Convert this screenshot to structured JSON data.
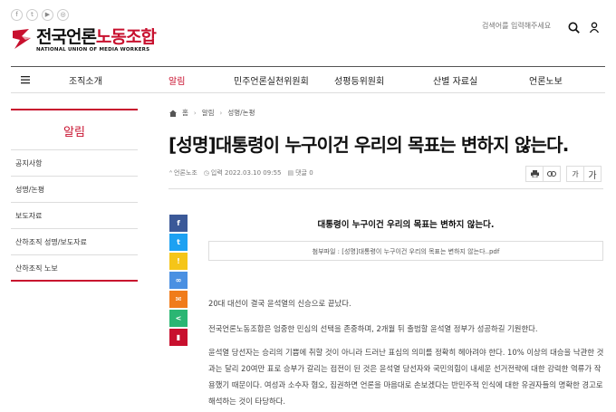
{
  "social": [
    "f",
    "t",
    "▶",
    "◎"
  ],
  "logo": {
    "ko_prefix": "전국언론",
    "ko_suffix": "노동조합",
    "en": "NATIONAL UNION OF MEDIA WORKERS"
  },
  "search": {
    "placeholder": "검색어를 입력해주세요"
  },
  "nav": {
    "items": [
      "조직소개",
      "알림",
      "민주언론실천위원회",
      "성평등위원회",
      "산별 자료실",
      "언론노보"
    ],
    "active": "알림"
  },
  "sidebar": {
    "title": "알림",
    "items": [
      "공지사항",
      "성명/논평",
      "보도자료",
      "산하조직 성명/보도자료",
      "산하조직 노보"
    ]
  },
  "breadcrumb": {
    "home": "홈",
    "level1": "알림",
    "level2": "성명/논평"
  },
  "article": {
    "title": "[성명]대통령이 누구이건 우리의 목표는 변하지 않는다.",
    "author": "언론노조",
    "date": "입력 2022.03.10 09:55",
    "comments": "댓글 0",
    "font_small": "가",
    "font_large": "가",
    "subhead": "대통령이 누구이건 우리의 목표는 변하지 않는다.",
    "attachment": "첨부파일 : [성명]대통령이 누구이건 우리의 목표는 변하지 않는다..pdf",
    "paragraphs": [
      "20대 대선이 결국 윤석열의 신승으로 끝났다.",
      "전국언론노동조합은 엄중한 민심의 선택을 존중하며, 2개월 뒤 출범할 윤석열 정부가 성공하길 기원한다.",
      "윤석열 당선자는 승리의 기쁨에 취할 것이 아니라 드러난 표심의 의미를 정확히 헤아려야 한다. 10% 이상의 대승을 낙관한 것과는 달리 20여만 표로 승부가 갈리는 접전이 된 것은 윤석열 당선자와 국민의힘이 내세운 선거전략에 대한 강력한 역류가 작용했기 때문이다. 여성과 소수자 혐오, 집권하면 언론을 마음대로 손보겠다는 반민주적 인식에 대한 유권자들의 명확한 경고로 해석하는 것이 타당하다."
    ]
  },
  "share_colors": [
    "#3b5998",
    "#1da1f2",
    "#f5c518",
    "#4a90e2",
    "#f07c1b",
    "#2bb673",
    "#c8102e"
  ],
  "accent": "#c8102e"
}
